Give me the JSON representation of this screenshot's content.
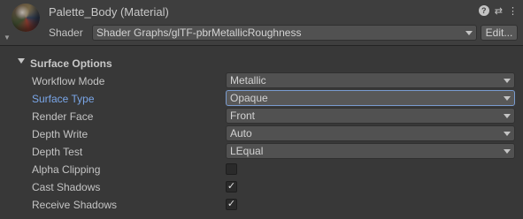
{
  "header": {
    "title": "Palette_Body (Material)",
    "help_glyph": "?",
    "settings_glyph": "⇄",
    "menu_glyph": "⋮",
    "shader_label": "Shader",
    "shader_value": "Shader Graphs/glTF-pbrMetallicRoughness",
    "edit_label": "Edit..."
  },
  "section": {
    "title": "Surface Options"
  },
  "rows": [
    {
      "label": "Workflow Mode",
      "value": "Metallic"
    },
    {
      "label": "Surface Type",
      "value": "Opaque"
    },
    {
      "label": "Render Face",
      "value": "Front"
    },
    {
      "label": "Depth Write",
      "value": "Auto"
    },
    {
      "label": "Depth Test",
      "value": "LEqual"
    },
    {
      "label": "Alpha Clipping",
      "checked": false
    },
    {
      "label": "Cast Shadows",
      "checked": true
    },
    {
      "label": "Receive Shadows",
      "checked": true
    }
  ],
  "check_glyph": "✓",
  "colors": {
    "background": "#383838",
    "field": "#515151",
    "active_label": "#7aa6e8",
    "focus_border": "#7a9cd0"
  }
}
